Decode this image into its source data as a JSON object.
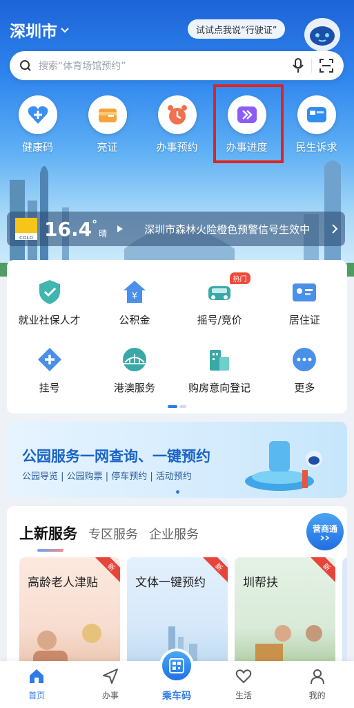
{
  "header": {
    "city": "深圳市",
    "assistant_prompt": "试试点我说“行驶证”"
  },
  "search": {
    "placeholder": "搜索“体育场馆预约”"
  },
  "quick_actions": [
    {
      "label": "健康码",
      "icon": "health-code-icon"
    },
    {
      "label": "亮证",
      "icon": "id-wallet-icon"
    },
    {
      "label": "办事预约",
      "icon": "alarm-clock-icon"
    },
    {
      "label": "办事进度",
      "icon": "progress-arrows-icon"
    },
    {
      "label": "民生诉求",
      "icon": "petition-icon"
    }
  ],
  "weather": {
    "temperature": "16.4",
    "degree": "°",
    "condition": "晴",
    "badge": "COLD",
    "notice": "深圳市森林火险橙色预警信号生效中"
  },
  "services": [
    {
      "label": "就业社保人才",
      "icon": "shield-check-icon"
    },
    {
      "label": "公积金",
      "icon": "house-fund-icon"
    },
    {
      "label": "摇号/竞价",
      "icon": "car-icon",
      "badge": "热门"
    },
    {
      "label": "居住证",
      "icon": "id-card-icon"
    },
    {
      "label": "挂号",
      "icon": "medical-cross-icon"
    },
    {
      "label": "港澳服务",
      "icon": "bridge-icon"
    },
    {
      "label": "购房意向登记",
      "icon": "building-icon"
    },
    {
      "label": "更多",
      "icon": "more-dots-icon"
    }
  ],
  "banner": {
    "title": "公园服务一网查询、一键预约",
    "subtitle": "公园导览 | 公园购票 | 停车预约 | 活动预约"
  },
  "new_services": {
    "tabs": [
      "上新服务",
      "专区服务",
      "企业服务"
    ],
    "badge_button": "营商通",
    "cards": [
      {
        "title": "高龄老人津贴",
        "ribbon": "新"
      },
      {
        "title": "文体一键预约",
        "ribbon": "新"
      },
      {
        "title": "圳帮扶",
        "ribbon": "新"
      }
    ]
  },
  "bottom_nav": [
    {
      "label": "首页",
      "icon": "home-icon"
    },
    {
      "label": "办事",
      "icon": "send-icon"
    },
    {
      "label": "乘车码",
      "icon": "qr-bus-icon"
    },
    {
      "label": "生活",
      "icon": "heart-icon"
    },
    {
      "label": "我的",
      "icon": "user-icon"
    }
  ],
  "colors": {
    "accent": "#2f7bea",
    "highlight": "#e0231c",
    "hot": "#ef4b3b"
  }
}
